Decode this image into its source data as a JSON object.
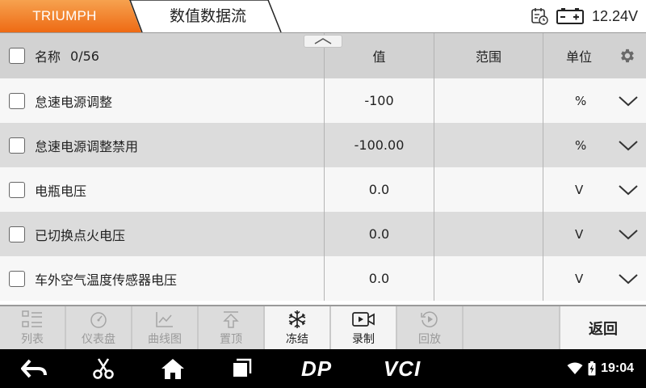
{
  "topbar": {
    "brand": "TRIUMPH",
    "title": "数值数据流",
    "voltage": "12.24V",
    "colors": {
      "brand_orange": "#f07a22",
      "brand_orange_light": "#f4a05a"
    }
  },
  "table": {
    "header": {
      "name": "名称",
      "count": "0/56",
      "value": "值",
      "range": "范围",
      "unit": "单位"
    },
    "rows": [
      {
        "name": "怠速电源调整",
        "value": "-100",
        "range": "",
        "unit": "%"
      },
      {
        "name": "怠速电源调整禁用",
        "value": "-100.00",
        "range": "",
        "unit": "%"
      },
      {
        "name": "电瓶电压",
        "value": "0.0",
        "range": "",
        "unit": "V"
      },
      {
        "name": "已切换点火电压",
        "value": "0.0",
        "range": "",
        "unit": "V"
      },
      {
        "name": "车外空气温度传感器电压",
        "value": "0.0",
        "range": "",
        "unit": "V"
      }
    ]
  },
  "toolbar": {
    "items": [
      {
        "label": "列表",
        "icon": "list-icon",
        "enabled": false
      },
      {
        "label": "仪表盘",
        "icon": "gauge-icon",
        "enabled": false
      },
      {
        "label": "曲线图",
        "icon": "line-chart-icon",
        "enabled": false
      },
      {
        "label": "置顶",
        "icon": "pin-top-icon",
        "enabled": false
      },
      {
        "label": "冻结",
        "icon": "snowflake-icon",
        "enabled": true
      },
      {
        "label": "录制",
        "icon": "record-video-icon",
        "enabled": true
      },
      {
        "label": "回放",
        "icon": "playback-icon",
        "enabled": false
      }
    ],
    "back": "返回"
  },
  "navbar": {
    "logo_dp": "DP",
    "logo_vci": "VCI",
    "time": "19:04"
  }
}
